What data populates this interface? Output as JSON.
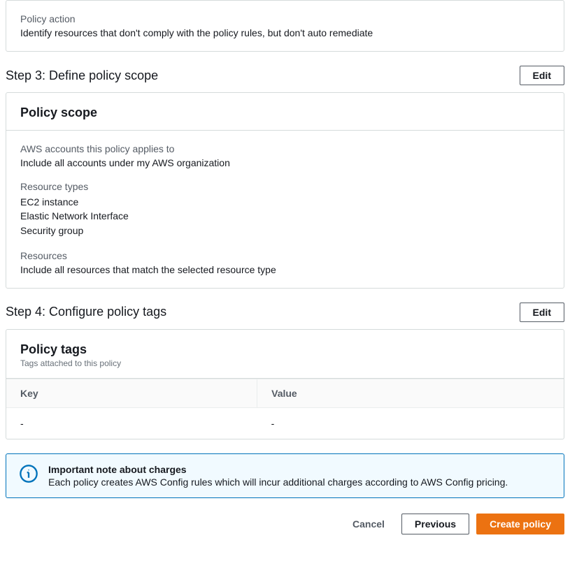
{
  "policy_action": {
    "label": "Policy action",
    "value": "Identify resources that don't comply with the policy rules, but don't auto remediate"
  },
  "step3": {
    "title": "Step 3: Define policy scope",
    "edit_label": "Edit",
    "panel_title": "Policy scope",
    "accounts": {
      "label": "AWS accounts this policy applies to",
      "value": "Include all accounts under my AWS organization"
    },
    "resource_types": {
      "label": "Resource types",
      "items": [
        "EC2 instance",
        "Elastic Network Interface",
        "Security group"
      ]
    },
    "resources": {
      "label": "Resources",
      "value": "Include all resources that match the selected resource type"
    }
  },
  "step4": {
    "title": "Step 4: Configure policy tags",
    "edit_label": "Edit",
    "panel_title": "Policy tags",
    "panel_subtitle": "Tags attached to this policy",
    "columns": {
      "key": "Key",
      "value": "Value"
    },
    "rows": [
      {
        "key": "-",
        "value": "-"
      }
    ]
  },
  "info": {
    "title": "Important note about charges",
    "body": "Each policy creates AWS Config rules which will incur additional charges according to AWS Config pricing."
  },
  "footer": {
    "cancel": "Cancel",
    "previous": "Previous",
    "create": "Create policy"
  }
}
